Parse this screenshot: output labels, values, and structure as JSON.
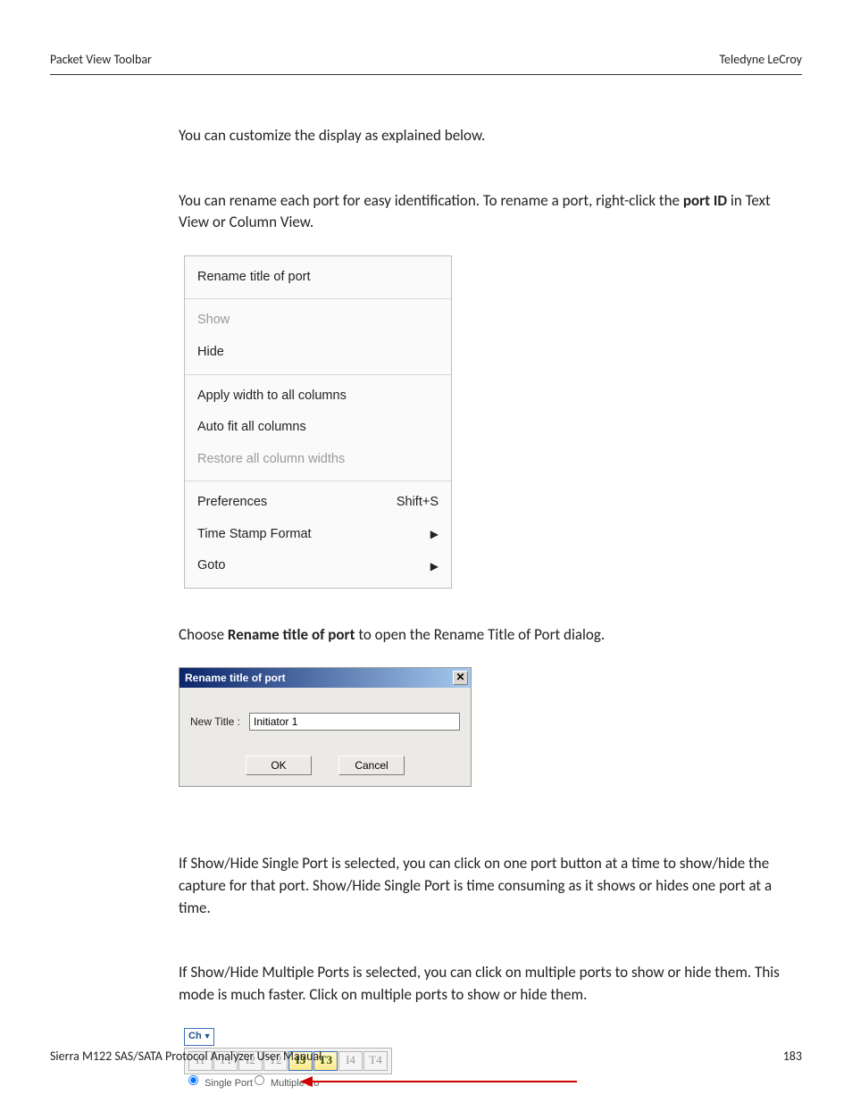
{
  "header": {
    "left": "Packet View Toolbar",
    "right": "Teledyne LeCroy"
  },
  "para1": "You can customize the display as explained below.",
  "para2_before": "You can rename each port for easy identification. To rename a port, right-click the ",
  "para2_bold": "port ID",
  "para2_after": " in Text View or Column View.",
  "ctx": {
    "g1": [
      {
        "label": "Rename title of port",
        "disabled": false
      }
    ],
    "g2": [
      {
        "label": "Show",
        "disabled": true
      },
      {
        "label": "Hide",
        "disabled": false
      }
    ],
    "g3": [
      {
        "label": "Apply width to all columns",
        "disabled": false
      },
      {
        "label": "Auto fit all columns",
        "disabled": false
      },
      {
        "label": "Restore all column widths",
        "disabled": true
      }
    ],
    "g4": [
      {
        "label": "Preferences",
        "shortcut": "Shift+S"
      },
      {
        "label": "Time Stamp Format",
        "submenu": true
      },
      {
        "label": "Goto",
        "submenu": true
      }
    ]
  },
  "para3_before": "Choose ",
  "para3_bold": "Rename title of port",
  "para3_after": " to open the Rename Title of Port dialog.",
  "dlg": {
    "title": "Rename title of port",
    "close": "✕",
    "label": "New Title :",
    "value": "Initiator 1",
    "ok": "OK",
    "cancel": "Cancel"
  },
  "para4": "If Show/Hide Single Port is selected, you can click on one port button at a time to show/hide the capture for that port. Show/Hide Single Port is time consuming as it shows or hides one port at a time.",
  "para5": "If Show/Hide Multiple Ports is selected, you can click on multiple ports to show or hide them. This mode is much faster. Click on multiple ports to show or hide them.",
  "ports": {
    "ch": "Ch",
    "buttons": [
      {
        "label": "I1",
        "active": false
      },
      {
        "label": "T1",
        "active": false
      },
      {
        "label": "I2",
        "active": false
      },
      {
        "label": "T2",
        "active": false
      },
      {
        "label": "I3",
        "active": true
      },
      {
        "label": "T3",
        "active": true
      },
      {
        "label": "I4",
        "active": false
      },
      {
        "label": "T4",
        "active": false
      }
    ],
    "radio1": "Single Port",
    "radio2": "Multiple Po"
  },
  "footer": {
    "left": "Sierra M122 SAS/SATA Protocol Analyzer User Manual",
    "right": "183"
  }
}
